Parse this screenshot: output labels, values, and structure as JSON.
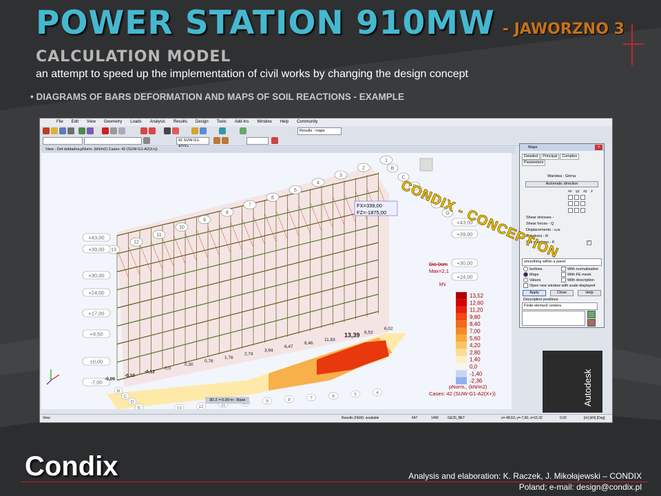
{
  "slide": {
    "title_main": "POWER STATION 910MW",
    "title_sub": "- JAWORZNO 3",
    "subtitle": "CALCULATION MODEL",
    "description": "an attempt to speed up the implementation of civil works by changing the design concept",
    "bullet": "• DIAGRAMS OF BARS DEFORMATION AND MAPS OF SOIL  REACTIONS - EXAMPLE",
    "stamp": "CONDIX - CONCEPTION",
    "logo": "Condix",
    "credit_line1": "Analysis and elaboration: K. Raczek, J. Mikołajewski – CONDIX",
    "credit_line2": "Poland; e-mail: design@condix.pl",
    "accent_color": "#45b8d0",
    "brand_red": "#c0272d"
  },
  "app": {
    "menu": [
      "File",
      "Edit",
      "View",
      "Geometry",
      "Loads",
      "Analysis",
      "Results",
      "Design",
      "Tools",
      "Add-Ins",
      "Window",
      "Help",
      "Community"
    ],
    "results_combo": "Results - maps",
    "case_combo": "42  SUW-G1-A2(X+",
    "view_title": "View - Def.doldadna;pNorm. (kN/m2) Cases: 42 (SUW-G1-A2(X+))",
    "view_tabs": "3D    Z = 0,00 m - Base",
    "status": {
      "left": "View",
      "results": "Results (FEM): available",
      "n1": "647",
      "n2": "1490",
      "section": "GE30_BET",
      "coords": "x=-48,63; y=-7,65; z=15,32",
      "angle": "0,00",
      "units": "[m] [kN] [Deg]"
    },
    "autodesk": "Autodesk"
  },
  "model_view": {
    "force_label_1": "FX=339,00",
    "force_label_2": "FZ=-1875,00",
    "dis_label": "Dis  0cm",
    "max_label": "Max=2,1",
    "kn_label": "kN",
    "grid_numbers": [
      "13",
      "12",
      "11",
      "10",
      "9",
      "8",
      "7",
      "6",
      "5",
      "4",
      "3",
      "2",
      "1"
    ],
    "grid_letters": [
      "B",
      "C",
      "D",
      "E",
      "F",
      "G"
    ],
    "levels": [
      "+43,00",
      "+39,00",
      "+30,00",
      "+24,00",
      "+17,00",
      "+9,50",
      "±0,00",
      "-7,00"
    ],
    "right_levels": [
      "+43,00",
      "+39,00",
      "+30,00",
      "+24,00"
    ],
    "bottom_letters": [
      "B",
      "C",
      "D",
      "E"
    ],
    "bottom_numbers": [
      "13",
      "12",
      "11",
      "10",
      "9",
      "8",
      "7",
      "6",
      "5",
      "4"
    ],
    "soil_values": [
      "-0,09",
      "-0,10",
      "-0,12",
      "0,0",
      "0,30",
      "0,76",
      "1,76",
      "2,74",
      "3,94",
      "6,47",
      "8,46",
      "11,83",
      "13,39",
      "6,53",
      "6,02"
    ],
    "legend_values": [
      "13,52",
      "12,60",
      "11,20",
      "9,80",
      "8,40",
      "7,00",
      "5,60",
      "4,20",
      "2,80",
      "1,40",
      "0,0",
      "-1,40",
      "-2,36"
    ],
    "legend_colors": [
      "#b30000",
      "#d40000",
      "#e8210a",
      "#f04a10",
      "#f46a18",
      "#f78a24",
      "#f9a83a",
      "#fbc462",
      "#fcdc94",
      "#fdeec8",
      "#f6f6ee",
      "#c9d6f3",
      "#8fb0ee"
    ],
    "legend_caption_1": "pNorm., (kN/m2)",
    "legend_caption_2": "Cases: 42 (SUW-G1-A2(X+))"
  },
  "maps_dialog": {
    "title": "Maps",
    "tabs": [
      "Detailed",
      "Principal",
      "Complex",
      "Parameters"
    ],
    "layer": "Warstwa : Górna",
    "auto_button": "Automatic direction",
    "col_headers": [
      "xx",
      "yy",
      "xy",
      "z"
    ],
    "rows": [
      "Shear stresses - ",
      "Shear forces - Q",
      "Displacements - u,w",
      "Rotations - R",
      "Soil reactions - K"
    ],
    "smoothing": "smoothing within a panel",
    "options_left": [
      "Isolines",
      "Maps",
      "Values"
    ],
    "options_right": [
      "With normalization",
      "With FE mesh",
      "With description"
    ],
    "open_new": "Open new window with scale displayed",
    "buttons": [
      "Apply",
      "Close",
      "Help"
    ],
    "desc_positions": "Description positions",
    "desc_combo": "Finite element centers"
  }
}
